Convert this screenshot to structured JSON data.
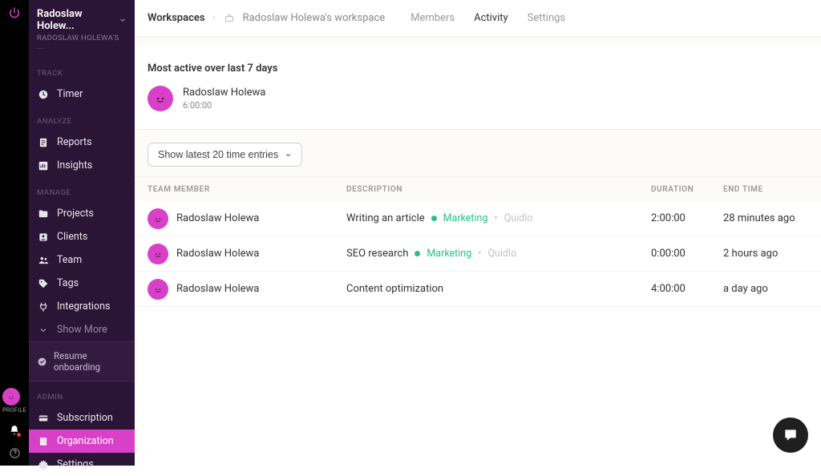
{
  "rail": {
    "profile_label": "PROFILE"
  },
  "sidebar": {
    "workspace_name": "Radoslaw Holew...",
    "workspace_sub": "RADOSLAW HOLEWA'S ...",
    "sections": {
      "track": {
        "title": "TRACK",
        "items": [
          {
            "label": "Timer"
          }
        ]
      },
      "analyze": {
        "title": "ANALYZE",
        "items": [
          {
            "label": "Reports"
          },
          {
            "label": "Insights"
          }
        ]
      },
      "manage": {
        "title": "MANAGE",
        "items": [
          {
            "label": "Projects"
          },
          {
            "label": "Clients"
          },
          {
            "label": "Team"
          },
          {
            "label": "Tags"
          },
          {
            "label": "Integrations"
          },
          {
            "label": "Show More"
          }
        ]
      },
      "resume": {
        "label": "Resume onboarding"
      },
      "admin": {
        "title": "ADMIN",
        "items": [
          {
            "label": "Subscription"
          },
          {
            "label": "Organization"
          },
          {
            "label": "Settings"
          }
        ]
      }
    }
  },
  "topbar": {
    "root": "Workspaces",
    "current": "Radoslaw Holewa's workspace",
    "tabs": {
      "members": "Members",
      "activity": "Activity",
      "settings": "Settings"
    }
  },
  "activity": {
    "section_title": "Most active over last 7 days",
    "top_user": {
      "name": "Radoslaw Holewa",
      "duration": "6:00:00"
    },
    "filter_label": "Show latest 20 time entries",
    "columns": {
      "member": "TEAM MEMBER",
      "desc": "DESCRIPTION",
      "dur": "DURATION",
      "end": "END TIME"
    },
    "rows": [
      {
        "member": "Radoslaw Holewa",
        "desc": "Writing an article",
        "tag": "Marketing",
        "project": "Quidlo",
        "duration": "2:00:00",
        "end": "28 minutes ago"
      },
      {
        "member": "Radoslaw Holewa",
        "desc": "SEO research",
        "tag": "Marketing",
        "project": "Quidlo",
        "duration": "0:00:00",
        "end": "2 hours ago"
      },
      {
        "member": "Radoslaw Holewa",
        "desc": "Content optimization",
        "tag": "",
        "project": "",
        "duration": "4:00:00",
        "end": "a day ago"
      }
    ]
  }
}
